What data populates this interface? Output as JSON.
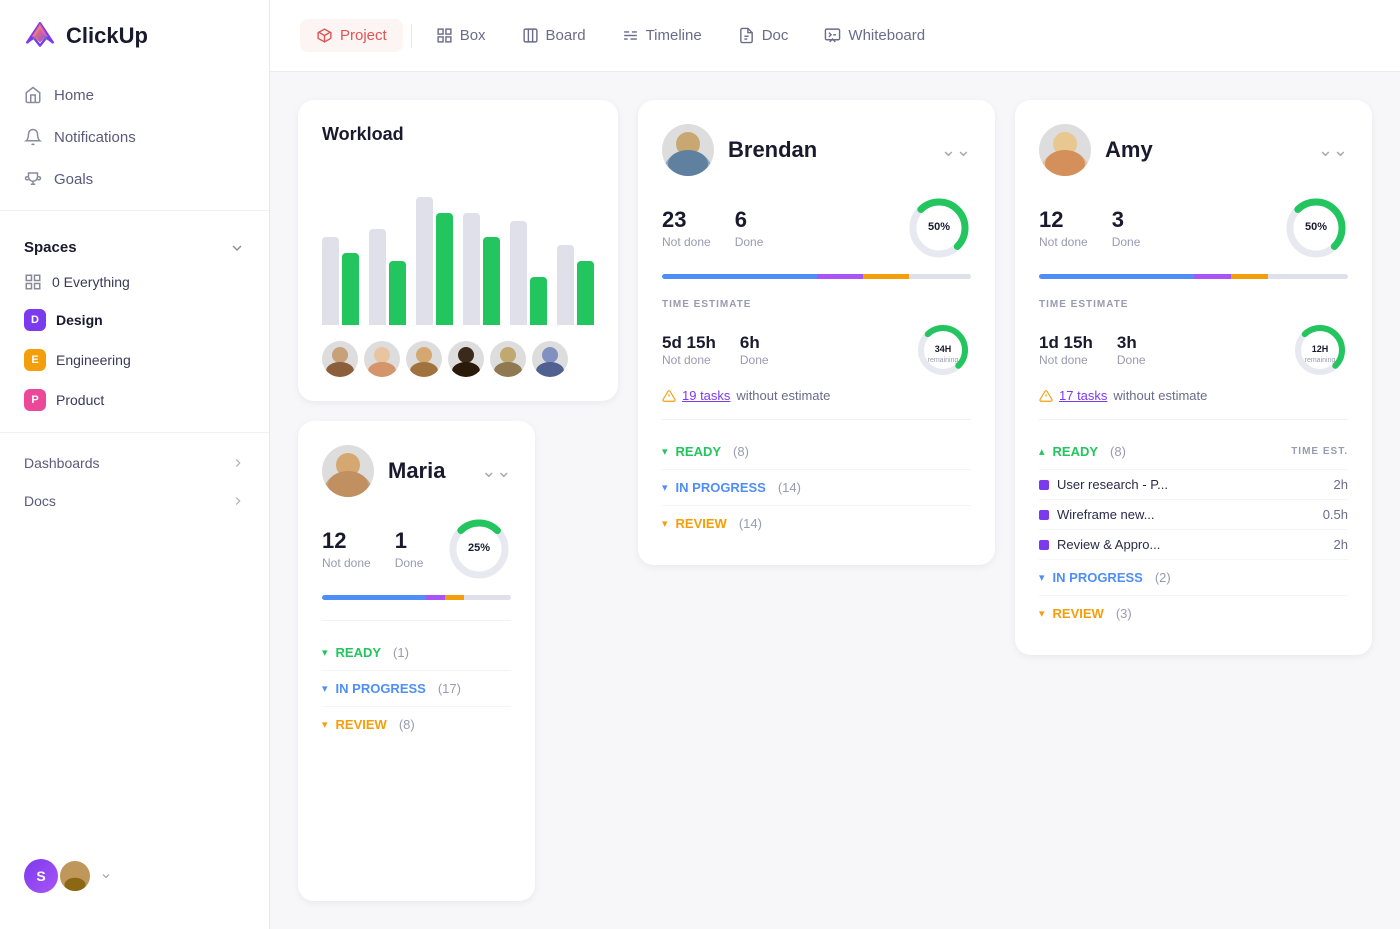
{
  "sidebar": {
    "logo_text": "ClickUp",
    "nav_items": [
      {
        "label": "Home",
        "icon": "home-icon"
      },
      {
        "label": "Notifications",
        "icon": "bell-icon"
      },
      {
        "label": "Goals",
        "icon": "trophy-icon"
      }
    ],
    "spaces_label": "Spaces",
    "everything_label": "Everything",
    "spaces": [
      {
        "label": "Design",
        "color": "#7c3aed",
        "letter": "D",
        "active": true
      },
      {
        "label": "Engineering",
        "color": "#f59e0b",
        "letter": "E"
      },
      {
        "label": "Product",
        "color": "#ec4899",
        "letter": "P"
      }
    ],
    "footer_items": [
      {
        "label": "Dashboards",
        "has_arrow": true
      },
      {
        "label": "Docs",
        "has_arrow": true
      }
    ]
  },
  "topnav": {
    "items": [
      {
        "label": "Project",
        "icon": "box-icon",
        "active": true
      },
      {
        "label": "Box",
        "icon": "grid-icon"
      },
      {
        "label": "Board",
        "icon": "columns-icon"
      },
      {
        "label": "Timeline",
        "icon": "timeline-icon"
      },
      {
        "label": "Doc",
        "icon": "doc-icon"
      },
      {
        "label": "Whiteboard",
        "icon": "whiteboard-icon"
      }
    ]
  },
  "workload": {
    "title": "Workload",
    "bars": [
      {
        "grey": 55,
        "green": 45
      },
      {
        "grey": 60,
        "green": 40
      },
      {
        "grey": 80,
        "green": 70
      },
      {
        "grey": 70,
        "green": 55
      },
      {
        "grey": 65,
        "green": 30
      },
      {
        "grey": 50,
        "green": 40
      }
    ]
  },
  "brendan": {
    "name": "Brendan",
    "not_done": 23,
    "done": 6,
    "percent": "50%",
    "percent_num": 50,
    "time_estimate_title": "TIME ESTIMATE",
    "not_done_time": "5d 15h",
    "done_time": "6h",
    "hours_label": "34H",
    "warning_text_pre": "19 tasks",
    "warning_text_post": "without estimate",
    "statuses": [
      {
        "label": "READY",
        "count": "(8)",
        "type": "ready"
      },
      {
        "label": "IN PROGRESS",
        "count": "(14)",
        "type": "inprogress"
      },
      {
        "label": "REVIEW",
        "count": "(14)",
        "type": "review"
      }
    ]
  },
  "amy": {
    "name": "Amy",
    "not_done": 12,
    "done": 3,
    "percent": "50%",
    "percent_num": 50,
    "time_estimate_title": "TIME ESTIMATE",
    "not_done_time": "1d 15h",
    "done_time": "3h",
    "hours_label": "12H",
    "warning_text_pre": "17 tasks",
    "warning_text_post": "without estimate",
    "ready_label": "READY",
    "ready_count": "(8)",
    "time_est_col": "TIME EST.",
    "tasks": [
      {
        "name": "User research - P...",
        "time": "2h"
      },
      {
        "name": "Wireframe new...",
        "time": "0.5h"
      },
      {
        "name": "Review & Appro...",
        "time": "2h"
      }
    ],
    "in_progress_label": "IN PROGRESS",
    "in_progress_count": "(2)",
    "review_label": "REVIEW",
    "review_count": "(3)"
  },
  "maria": {
    "name": "Maria",
    "not_done": 12,
    "done": 1,
    "percent": "25%",
    "percent_num": 25,
    "statuses": [
      {
        "label": "READY",
        "count": "(1)",
        "type": "ready"
      },
      {
        "label": "IN PROGRESS",
        "count": "(17)",
        "type": "inprogress"
      },
      {
        "label": "REVIEW",
        "count": "(8)",
        "type": "review"
      }
    ]
  },
  "labels": {
    "not_done": "Not done",
    "done": "Done",
    "everything": "0 Everything"
  }
}
